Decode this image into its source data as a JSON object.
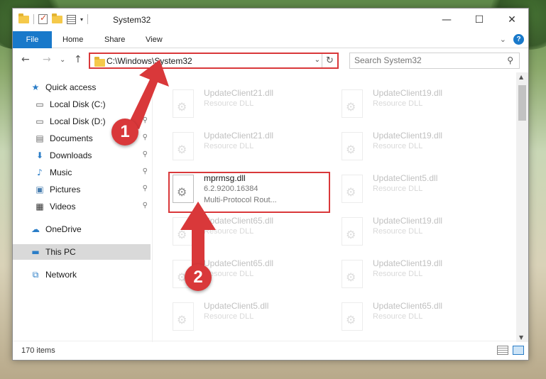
{
  "window": {
    "title": "System32",
    "controls": {
      "minimize": "—",
      "maximize": "☐",
      "close": "✕"
    }
  },
  "ribbon": {
    "tabs": [
      "File",
      "Home",
      "Share",
      "View"
    ],
    "collapse": "⌄",
    "help": "?"
  },
  "nav": {
    "back": "←",
    "forward": "→",
    "recent": "⌄",
    "up": "↑",
    "address": "C:\\Windows\\System32",
    "address_dropdown": "⌄",
    "refresh": "↻",
    "search_placeholder": "Search System32",
    "search_icon": "⚲"
  },
  "sidebar": {
    "items": [
      {
        "label": "Quick access",
        "icon": "star-icon",
        "glyph": "★",
        "color": "#2a7dc7",
        "pinned": false
      },
      {
        "label": "Local Disk (C:)",
        "icon": "drive-icon",
        "glyph": "▭",
        "color": "#555555",
        "pinned": true
      },
      {
        "label": "Local Disk (D:)",
        "icon": "drive-icon",
        "glyph": "▭",
        "color": "#555555",
        "pinned": true
      },
      {
        "label": "Documents",
        "icon": "documents-icon",
        "glyph": "▤",
        "color": "#6b6b6b",
        "pinned": true
      },
      {
        "label": "Downloads",
        "icon": "download-icon",
        "glyph": "⬇",
        "color": "#2a7dc7",
        "pinned": true
      },
      {
        "label": "Music",
        "icon": "music-icon",
        "glyph": "♪",
        "color": "#2a7dc7",
        "pinned": true
      },
      {
        "label": "Pictures",
        "icon": "pictures-icon",
        "glyph": "▣",
        "color": "#4a7fb0",
        "pinned": true
      },
      {
        "label": "Videos",
        "icon": "video-icon",
        "glyph": "▦",
        "color": "#333333",
        "pinned": true
      },
      {
        "label": "OneDrive",
        "icon": "cloud-icon",
        "glyph": "☁",
        "color": "#2a7dc7",
        "pinned": false
      },
      {
        "label": "This PC",
        "icon": "computer-icon",
        "glyph": "▬",
        "color": "#2a7dc7",
        "pinned": false,
        "selected": true
      },
      {
        "label": "Network",
        "icon": "network-icon",
        "glyph": "⧉",
        "color": "#2a7dc7",
        "pinned": false
      }
    ],
    "pin_glyph": "📌"
  },
  "files": [
    {
      "name": "UpdateClient21.dll",
      "desc": "Resource DLL",
      "faded": true
    },
    {
      "name": "UpdateClient19.dll",
      "desc": "Resource DLL",
      "faded": true
    },
    {
      "name": "UpdateClient21.dll",
      "desc": "Resource DLL",
      "faded": true
    },
    {
      "name": "UpdateClient19.dll",
      "desc": "Resource DLL",
      "faded": true
    },
    {
      "name": "mprmsg.dll",
      "desc": "6.2.9200.16384",
      "desc2": "Multi-Protocol Rout...",
      "faded": false,
      "highlighted": true
    },
    {
      "name": "UpdateClient5.dll",
      "desc": "Resource DLL",
      "faded": true
    },
    {
      "name": "UpdateClient65.dll",
      "desc": "Resource DLL",
      "faded": true
    },
    {
      "name": "UpdateClient19.dll",
      "desc": "Resource DLL",
      "faded": true
    },
    {
      "name": "UpdateClient65.dll",
      "desc": "Resource DLL",
      "faded": true
    },
    {
      "name": "UpdateClient19.dll",
      "desc": "Resource DLL",
      "faded": true
    },
    {
      "name": "UpdateClient5.dll",
      "desc": "Resource DLL",
      "faded": true
    },
    {
      "name": "UpdateClient65.dll",
      "desc": "Resource DLL",
      "faded": true
    }
  ],
  "status": {
    "items": "170 items"
  },
  "annotations": {
    "step1": "1",
    "step2": "2",
    "accent": "#d9383a"
  }
}
